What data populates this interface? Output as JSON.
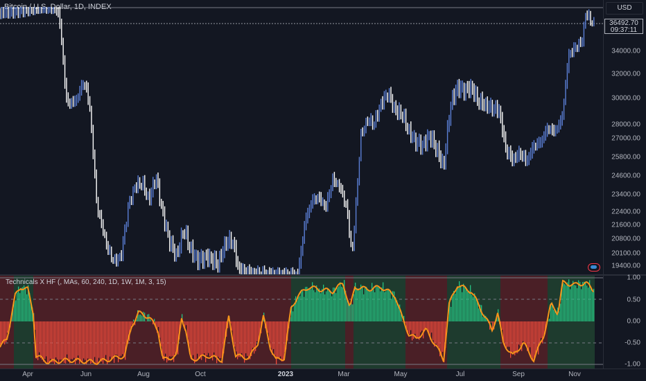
{
  "symbol": {
    "title": "Bitcoin / U.S. Dollar, 1D, INDEX"
  },
  "currency": "USD",
  "last_price": {
    "value": "36492.70",
    "countdown": "09:37:11"
  },
  "indicator": {
    "title": "Technicals X HF (, MAs, 60, 240, 1D, 1W, 1M, 3, 15)"
  },
  "price_axis": [
    "34000.00",
    "32000.00",
    "30000.00",
    "28000.00",
    "27000.00",
    "25800.00",
    "24600.00",
    "23400.00",
    "22400.00",
    "21600.00",
    "20800.00",
    "20100.00",
    "19400.00"
  ],
  "osc_axis": [
    "1.00",
    "0.50",
    "0.00",
    "-0.50",
    "-1.00"
  ],
  "time_axis": [
    {
      "label": "Apr",
      "bold": false
    },
    {
      "label": "Jun",
      "bold": false
    },
    {
      "label": "Aug",
      "bold": false
    },
    {
      "label": "Oct",
      "bold": false
    },
    {
      "label": "2023",
      "bold": true
    },
    {
      "label": "Mar",
      "bold": false
    },
    {
      "label": "May",
      "bold": false
    },
    {
      "label": "Jul",
      "bold": false
    },
    {
      "label": "Sep",
      "bold": false
    },
    {
      "label": "Nov",
      "bold": false
    }
  ],
  "colors": {
    "background": "#131722",
    "candle": "#ffffff",
    "candle_up": "#5b7fd6",
    "osc_line": "#f7931a",
    "hist_pos": "#26c281",
    "hist_neg": "#ef4b3c",
    "bg_pos": "#1e3b2e",
    "bg_neg": "#4a1f26"
  }
}
